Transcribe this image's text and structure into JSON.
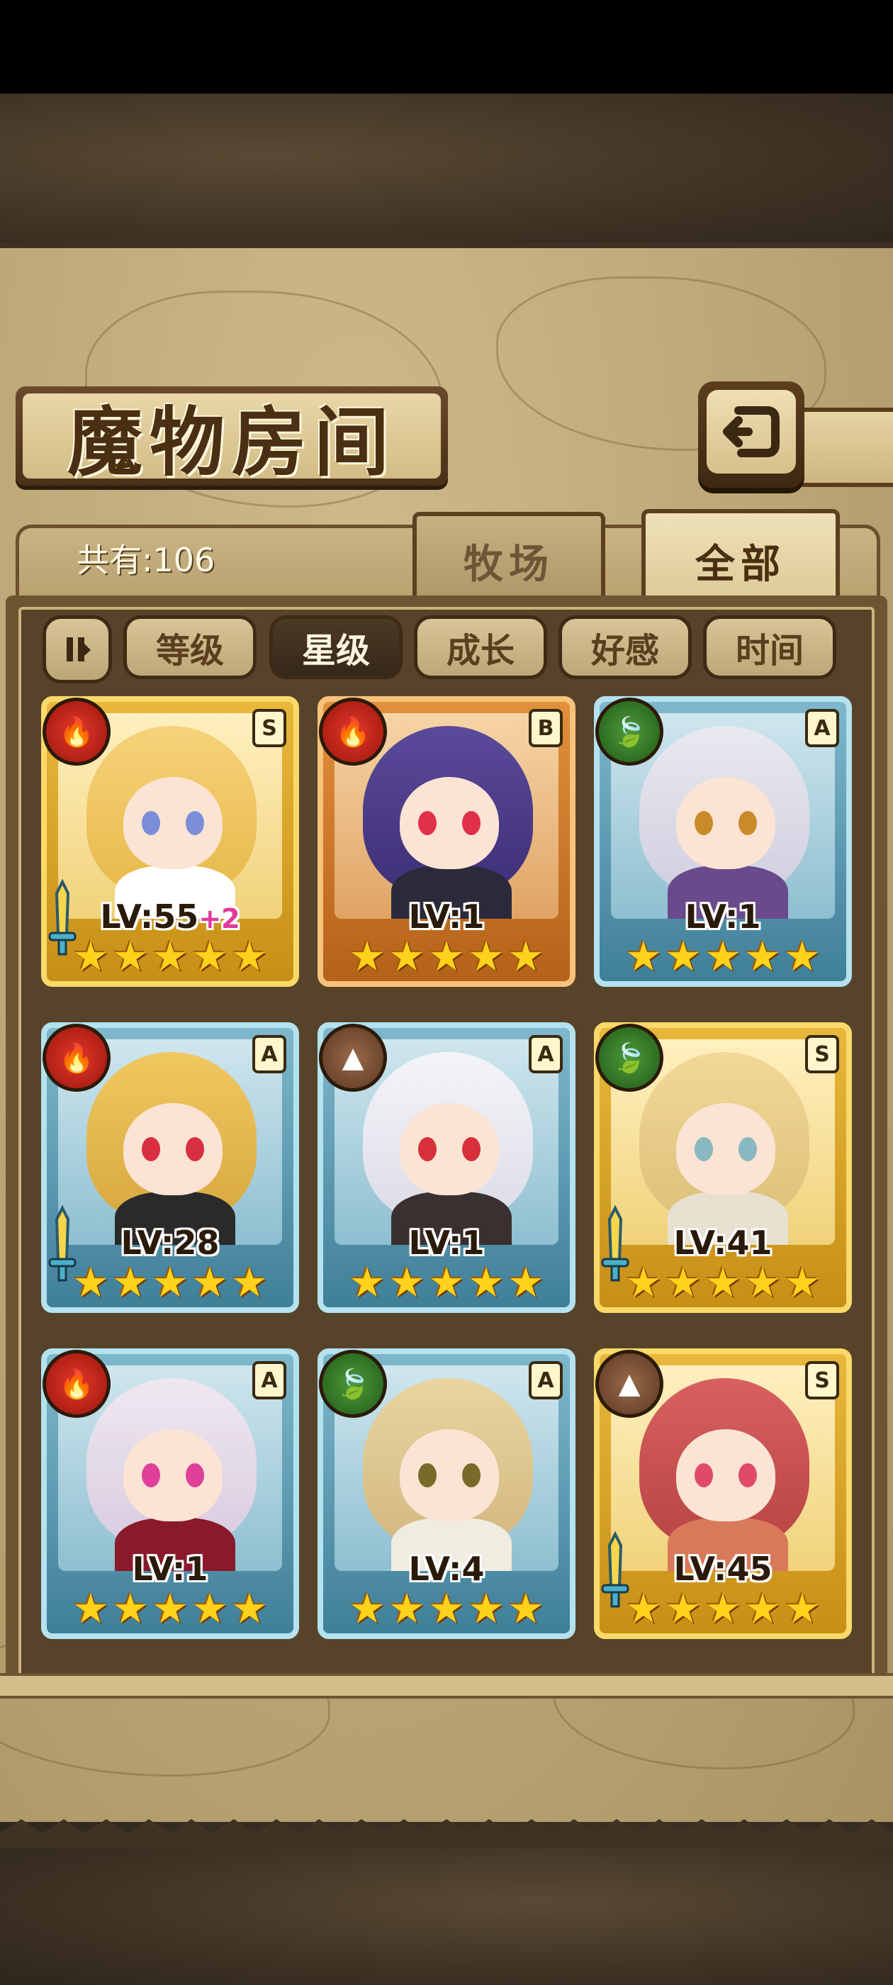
{
  "header": {
    "title": "魔物房间",
    "count_text": "共有:106"
  },
  "tabs": {
    "farm": "牧场",
    "all": "全部"
  },
  "filters": {
    "toggle_icon": "pause-bars-icon",
    "items": [
      "等级",
      "星级",
      "成长",
      "好感",
      "时间"
    ],
    "active": "星级"
  },
  "colors": {
    "fire": "#d4281c",
    "leaf": "#2f7a22",
    "earth": "#7a5236",
    "gold_frame": "#e7b83b",
    "blue_frame": "#5a9fb8",
    "orange_frame": "#d27a2a"
  },
  "monsters": [
    {
      "element": "fire",
      "rank": "S",
      "level": "LV:55",
      "bonus": "+2",
      "stars": 5,
      "frame": "gold",
      "weapon": true
    },
    {
      "element": "fire",
      "rank": "B",
      "level": "LV:1",
      "bonus": "",
      "stars": 5,
      "frame": "orange",
      "weapon": false
    },
    {
      "element": "leaf",
      "rank": "A",
      "level": "LV:1",
      "bonus": "",
      "stars": 5,
      "frame": "blue",
      "weapon": false
    },
    {
      "element": "fire",
      "rank": "A",
      "level": "LV:28",
      "bonus": "",
      "stars": 5,
      "frame": "blue",
      "weapon": true
    },
    {
      "element": "earth",
      "rank": "A",
      "level": "LV:1",
      "bonus": "",
      "stars": 5,
      "frame": "blue",
      "weapon": false
    },
    {
      "element": "leaf",
      "rank": "S",
      "level": "LV:41",
      "bonus": "",
      "stars": 5,
      "frame": "gold",
      "weapon": true
    },
    {
      "element": "fire",
      "rank": "A",
      "level": "LV:1",
      "bonus": "",
      "stars": 5,
      "frame": "blue",
      "weapon": false
    },
    {
      "element": "leaf",
      "rank": "A",
      "level": "LV:4",
      "bonus": "",
      "stars": 5,
      "frame": "blue",
      "weapon": false
    },
    {
      "element": "earth",
      "rank": "S",
      "level": "LV:45",
      "bonus": "",
      "stars": 5,
      "frame": "gold",
      "weapon": true
    }
  ]
}
